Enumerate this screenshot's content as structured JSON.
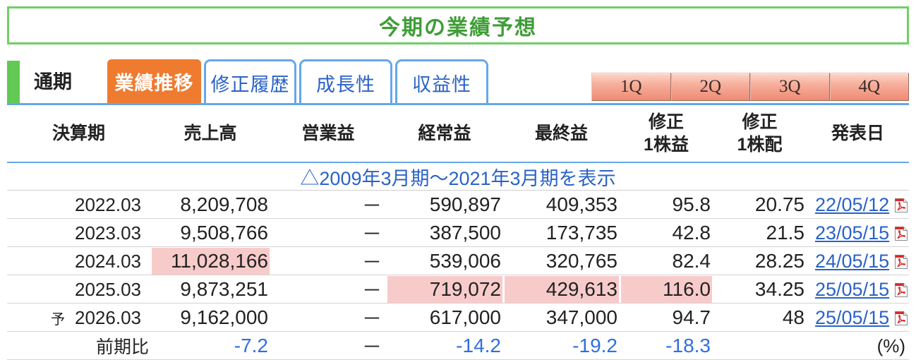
{
  "title": "今期の業績予想",
  "tab_bar": {
    "period_label": "通期",
    "tabs": [
      {
        "label": "業績推移",
        "active": true
      },
      {
        "label": "修正履歴",
        "active": false
      },
      {
        "label": "成長性",
        "active": false
      },
      {
        "label": "収益性",
        "active": false
      }
    ],
    "quarter_buttons": [
      "1Q",
      "2Q",
      "3Q",
      "4Q"
    ]
  },
  "table": {
    "headers": {
      "period": "決算期",
      "sales": "売上高",
      "operating_profit": "営業益",
      "ordinary_profit": "経常益",
      "net_profit": "最終益",
      "eps": [
        "修正",
        "1株益"
      ],
      "dividend": [
        "修正",
        "1株配"
      ],
      "announce_date": "発表日"
    },
    "expand_link": "△2009年3月期～2021年3月期を表示",
    "date_icon": "pdf-icon",
    "rows": [
      {
        "period": "2022.03",
        "sales": "8,209,708",
        "operating_profit": "－",
        "ordinary_profit": "590,897",
        "net_profit": "409,353",
        "eps": "95.8",
        "dividend": "20.75",
        "announce_date": "22/05/12"
      },
      {
        "period": "2023.03",
        "sales": "9,508,766",
        "operating_profit": "－",
        "ordinary_profit": "387,500",
        "net_profit": "173,735",
        "eps": "42.8",
        "dividend": "21.5",
        "announce_date": "23/05/15"
      },
      {
        "period": "2024.03",
        "sales": "11,028,166",
        "operating_profit": "－",
        "ordinary_profit": "539,006",
        "net_profit": "320,765",
        "eps": "82.4",
        "dividend": "28.25",
        "announce_date": "24/05/15",
        "hl": {
          "sales": true
        }
      },
      {
        "period": "2025.03",
        "sales": "9,873,251",
        "operating_profit": "－",
        "ordinary_profit": "719,072",
        "net_profit": "429,613",
        "eps": "116.0",
        "dividend": "34.25",
        "announce_date": "25/05/15",
        "hl": {
          "ordinary_profit": true,
          "net_profit": true,
          "eps": true
        }
      },
      {
        "prefix": "予",
        "period": "2026.03",
        "sales": "9,162,000",
        "operating_profit": "－",
        "ordinary_profit": "617,000",
        "net_profit": "347,000",
        "eps": "94.7",
        "dividend": "48",
        "announce_date": "25/05/15"
      }
    ],
    "yoy": {
      "label": "前期比",
      "sales": "-7.2",
      "operating_profit": "－",
      "ordinary_profit": "-14.2",
      "net_profit": "-19.2",
      "eps": "-18.3",
      "unit": "(%)"
    }
  },
  "colors": {
    "title_green": "#3f9d37",
    "frame_green": "#6fd064",
    "bar_green": "#62c954",
    "active_tab": "#ef7b30",
    "tab_border": "#66a7ea",
    "link_blue": "#2a62c8",
    "highlight": "#f8cbcb",
    "negative_blue": "#2f6fe0"
  }
}
